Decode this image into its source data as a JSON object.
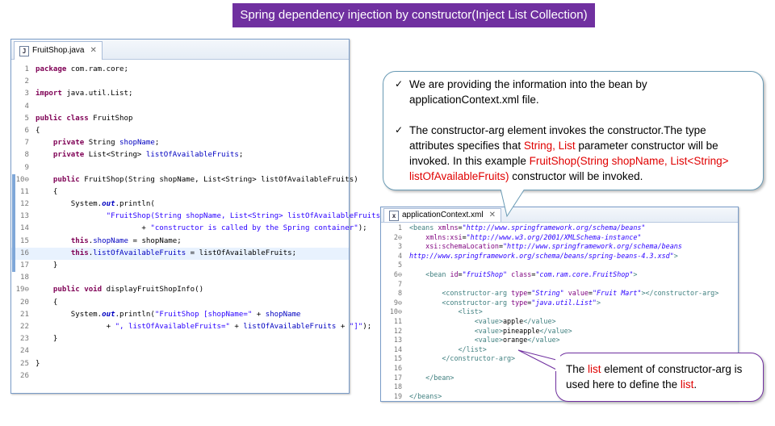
{
  "title": "Spring dependency injection by constructor(Inject List Collection)",
  "java_editor": {
    "tab_label": "FruitShop.java",
    "close": "✕",
    "lines": [
      {
        "num": "1",
        "html": "<span class=\"kw\">package</span> com.ram.core;"
      },
      {
        "num": "2",
        "html": ""
      },
      {
        "num": "3",
        "html": "<span class=\"kw\">import</span> java.util.List;"
      },
      {
        "num": "4",
        "html": ""
      },
      {
        "num": "5",
        "html": "<span class=\"kw\">public class</span> FruitShop"
      },
      {
        "num": "6",
        "html": "{"
      },
      {
        "num": "7",
        "html": "    <span class=\"kw\">private</span> String <span class=\"fld\">shopName</span>;"
      },
      {
        "num": "8",
        "html": "    <span class=\"kw\">private</span> List&lt;String&gt; <span class=\"fld\">listOfAvailableFruits</span>;"
      },
      {
        "num": "9",
        "html": ""
      },
      {
        "num": "10⊖",
        "html": "    <span class=\"kw\">public</span> FruitShop(String shopName, List&lt;String&gt; listOfAvailableFruits)"
      },
      {
        "num": "11",
        "html": "    {"
      },
      {
        "num": "12",
        "html": "        System.<span class=\"st\">out</span>.println("
      },
      {
        "num": "13",
        "html": "                <span class=\"str\">\"FruitShop(String shopName, List&lt;String&gt; listOfAvailableFruits) \"</span>"
      },
      {
        "num": "14",
        "html": "                        + <span class=\"str\">\"constructor is called by the Spring container\"</span>);"
      },
      {
        "num": "15",
        "html": "        <span class=\"kw\">this</span>.<span class=\"fld\">shopName</span> = shopName;"
      },
      {
        "num": "16",
        "html": "        <span class=\"kw\">this</span>.<span class=\"fld\">listOfAvailableFruits</span> = listOfAvailableFruits;"
      },
      {
        "num": "17",
        "html": "    }"
      },
      {
        "num": "18",
        "html": ""
      },
      {
        "num": "19⊖",
        "html": "    <span class=\"kw\">public void</span> displayFruitShopInfo()"
      },
      {
        "num": "20",
        "html": "    {"
      },
      {
        "num": "21",
        "html": "        System.<span class=\"st\">out</span>.println(<span class=\"str\">\"FruitShop [shopName=\"</span> + <span class=\"fld\">shopName</span>"
      },
      {
        "num": "22",
        "html": "                + <span class=\"str\">\", listOfAvailableFruits=\"</span> + <span class=\"fld\">listOfAvailableFruits</span> + <span class=\"str\">\"]\"</span>);"
      },
      {
        "num": "23",
        "html": "    }"
      },
      {
        "num": "24",
        "html": ""
      },
      {
        "num": "25",
        "html": "}"
      },
      {
        "num": "26",
        "html": ""
      }
    ]
  },
  "xml_editor": {
    "tab_label": "applicationContext.xml",
    "close": "✕",
    "lines": [
      {
        "num": "1",
        "html": "<span class=\"tag\">&lt;beans</span> <span class=\"att\">xmlns</span>=<span class=\"av\">\"http://www.springframework.org/schema/beans\"</span>"
      },
      {
        "num": "2⊖",
        "html": "    <span class=\"att\">xmlns:xsi</span>=<span class=\"av\">\"http://www.w3.org/2001/XMLSchema-instance\"</span>"
      },
      {
        "num": "3",
        "html": "    <span class=\"att\">xsi:schemaLocation</span>=<span class=\"av\">\"http://www.springframework.org/schema/beans</span>"
      },
      {
        "num": "4",
        "html": "<span class=\"av\">http://www.springframework.org/schema/beans/spring-beans-4.3.xsd\"</span><span class=\"tag\">&gt;</span>"
      },
      {
        "num": "5",
        "html": ""
      },
      {
        "num": "6⊖",
        "html": "    <span class=\"tag\">&lt;bean</span> <span class=\"att\">id</span>=<span class=\"av\">\"fruitShop\"</span> <span class=\"att\">class</span>=<span class=\"av\">\"com.ram.core.FruitShop\"</span><span class=\"tag\">&gt;</span>"
      },
      {
        "num": "7",
        "html": ""
      },
      {
        "num": "8",
        "html": "        <span class=\"tag\">&lt;constructor-arg</span> <span class=\"att\">type</span>=<span class=\"av\">\"String\"</span> <span class=\"att\">value</span>=<span class=\"av\">\"Fruit Mart\"</span><span class=\"tag\">&gt;&lt;/constructor-arg&gt;</span>"
      },
      {
        "num": "9⊖",
        "html": "        <span class=\"tag\">&lt;constructor-arg</span> <span class=\"att\">type</span>=<span class=\"av\">\"java.util.List\"</span><span class=\"tag\">&gt;</span>"
      },
      {
        "num": "10⊖",
        "html": "            <span class=\"tag\">&lt;list&gt;</span>"
      },
      {
        "num": "11",
        "html": "                <span class=\"tag\">&lt;value&gt;</span>apple<span class=\"tag\">&lt;/value&gt;</span>"
      },
      {
        "num": "12",
        "html": "                <span class=\"tag\">&lt;value&gt;</span>pineapple<span class=\"tag\">&lt;/value&gt;</span>"
      },
      {
        "num": "13",
        "html": "                <span class=\"tag\">&lt;value&gt;</span>orange<span class=\"tag\">&lt;/value&gt;</span>"
      },
      {
        "num": "14",
        "html": "            <span class=\"tag\">&lt;/list&gt;</span>"
      },
      {
        "num": "15",
        "html": "        <span class=\"tag\">&lt;/constructor-arg&gt;</span>"
      },
      {
        "num": "16",
        "html": ""
      },
      {
        "num": "17",
        "html": "    <span class=\"tag\">&lt;/bean&gt;</span>"
      },
      {
        "num": "18",
        "html": ""
      },
      {
        "num": "19",
        "html": "<span class=\"tag\">&lt;/beans&gt;</span>"
      }
    ]
  },
  "callout_top": {
    "check": "✓",
    "item1": "We are providing the information into the bean by applicationContext.xml file.",
    "item2_a": "The constructor-arg element invokes the constructor.The type attributes specifies that ",
    "item2_red1": "String, List",
    "item2_b": " parameter constructor will be invoked. In this example ",
    "item2_red2": "FruitShop(String shopName, List<String> listOfAvailableFruits)",
    "item2_c": " constructor will be invoked."
  },
  "callout_bottom": {
    "a": "The ",
    "red1": "list",
    "b": " element of constructor-arg is used here to define the ",
    "red2": "list",
    "c": "."
  },
  "colors": {
    "title_bg": "#7030a0",
    "keyword": "#7f0055",
    "string": "#2a00ff",
    "highlight": "#e00000"
  }
}
